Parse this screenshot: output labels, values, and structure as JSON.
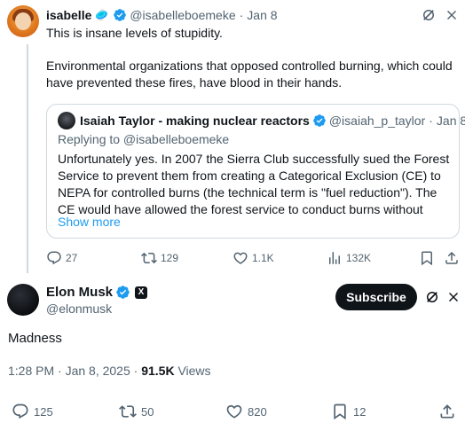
{
  "first_tweet": {
    "display_name": "isabelle",
    "emoji": "🥏",
    "handle": "@isabelleboemeke",
    "separator": "·",
    "date": "Jan 8",
    "line1": "This is insane levels of stupidity.",
    "line2": "Environmental organizations that opposed controlled burning, which could",
    "line3": "have prevented these fires, have blood in their hands.",
    "quote": {
      "display_name": "Isaiah Taylor - making nuclear reactors",
      "handle": "@isaiah_p_taylor",
      "separator": "·",
      "date": "Jan 8",
      "replying": "Replying to @isabelleboemeke",
      "body_lines": [
        "Unfortunately yes. In 2007 the Sierra Club successfully sued the Forest",
        "Service to prevent them from creating a Categorical Exclusion (CE) to",
        "NEPA for controlled burns (the technical term is \"fuel reduction\"). The",
        "CE would have allowed the forest service to conduct burns without"
      ],
      "show_more": "Show more"
    },
    "actions": {
      "replies": "27",
      "reposts": "129",
      "likes": "1.1K",
      "views": "132K"
    }
  },
  "reply_tweet": {
    "display_name": "Elon Musk",
    "badge_letter": "X",
    "handle": "@elonmusk",
    "subscribe_label": "Subscribe",
    "text": "Madness",
    "time": "1:28 PM · Jan 8, 2025 · ",
    "views_count": "91.5K",
    "views_label": " Views",
    "actions": {
      "replies": "125",
      "reposts": "50",
      "likes": "820",
      "bookmarks": "12"
    }
  },
  "colors": {
    "verified_blue": "#1d9bf0",
    "muted": "#536471",
    "text": "#0f1419",
    "border": "#cfd9de"
  }
}
